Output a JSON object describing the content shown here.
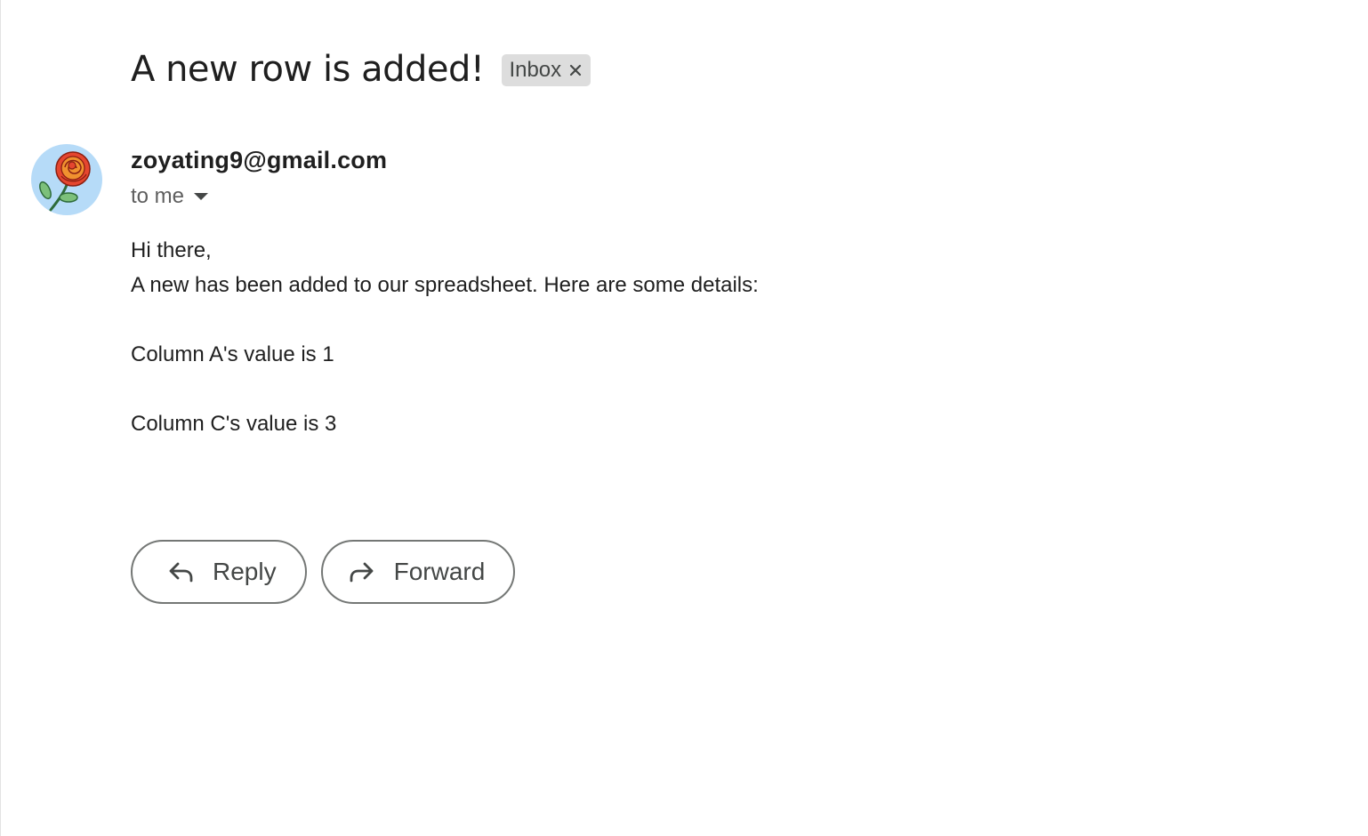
{
  "email": {
    "subject": "A new row is added!",
    "label": "Inbox",
    "sender": "zoyating9@gmail.com",
    "recipients": "to me",
    "body": {
      "greeting": "Hi there,",
      "intro": "A new has been added to our spreadsheet. Here are some details:",
      "line_a": "Column A's value is 1",
      "line_c": "Column C's value is 3"
    }
  },
  "actions": {
    "reply_label": "Reply",
    "forward_label": "Forward"
  },
  "icons": {
    "label_remove": "close-icon",
    "recipients_toggle": "caret-down-icon",
    "reply": "reply-icon",
    "forward": "forward-icon",
    "avatar": "rose-avatar"
  },
  "colors": {
    "avatar_bg": "#b6dbf8",
    "chip_bg": "#dddddd",
    "button_border": "#747775"
  }
}
